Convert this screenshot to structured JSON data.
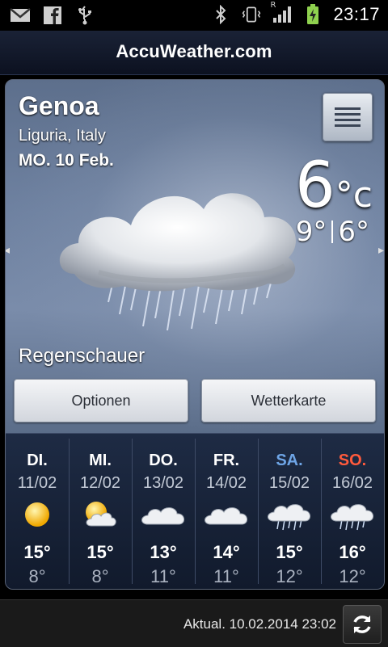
{
  "status_bar": {
    "time": "23:17",
    "icons_left": [
      "gmail-icon",
      "facebook-icon",
      "usb-icon"
    ],
    "icons_right": [
      "bluetooth-icon",
      "vibrate-icon",
      "signal-icon",
      "battery-charging-icon"
    ],
    "roaming_label": "R"
  },
  "header": {
    "brand": "AccuWeather.com"
  },
  "current": {
    "city": "Genoa",
    "region": "Liguria, Italy",
    "date": "MO. 10 Feb.",
    "temperature": "6",
    "unit": "°c",
    "high": "9°",
    "low": "6°",
    "condition": "Regenschauer"
  },
  "buttons": {
    "options": "Optionen",
    "map": "Wetterkarte"
  },
  "forecast": [
    {
      "day": "DI.",
      "date": "11/02",
      "icon": "sun-icon",
      "high": "15°",
      "low": "8°",
      "color": "#ffffff"
    },
    {
      "day": "MI.",
      "date": "12/02",
      "icon": "partly-cloudy-icon",
      "high": "15°",
      "low": "8°",
      "color": "#ffffff"
    },
    {
      "day": "DO.",
      "date": "13/02",
      "icon": "cloud-icon",
      "high": "13°",
      "low": "11°",
      "color": "#ffffff"
    },
    {
      "day": "FR.",
      "date": "14/02",
      "icon": "cloud-icon",
      "high": "14°",
      "low": "11°",
      "color": "#ffffff"
    },
    {
      "day": "SA.",
      "date": "15/02",
      "icon": "rain-cloud-icon",
      "high": "15°",
      "low": "12°",
      "color": "#6ea5e6"
    },
    {
      "day": "SO.",
      "date": "16/02",
      "icon": "rain-cloud-icon",
      "high": "16°",
      "low": "12°",
      "color": "#ff5a3c"
    }
  ],
  "footer": {
    "updated": "Aktual. 10.02.2014 23:02"
  },
  "colors": {
    "accent_saturday": "#6ea5e6",
    "accent_sunday": "#ff5a3c",
    "header_bg": "#111827"
  }
}
